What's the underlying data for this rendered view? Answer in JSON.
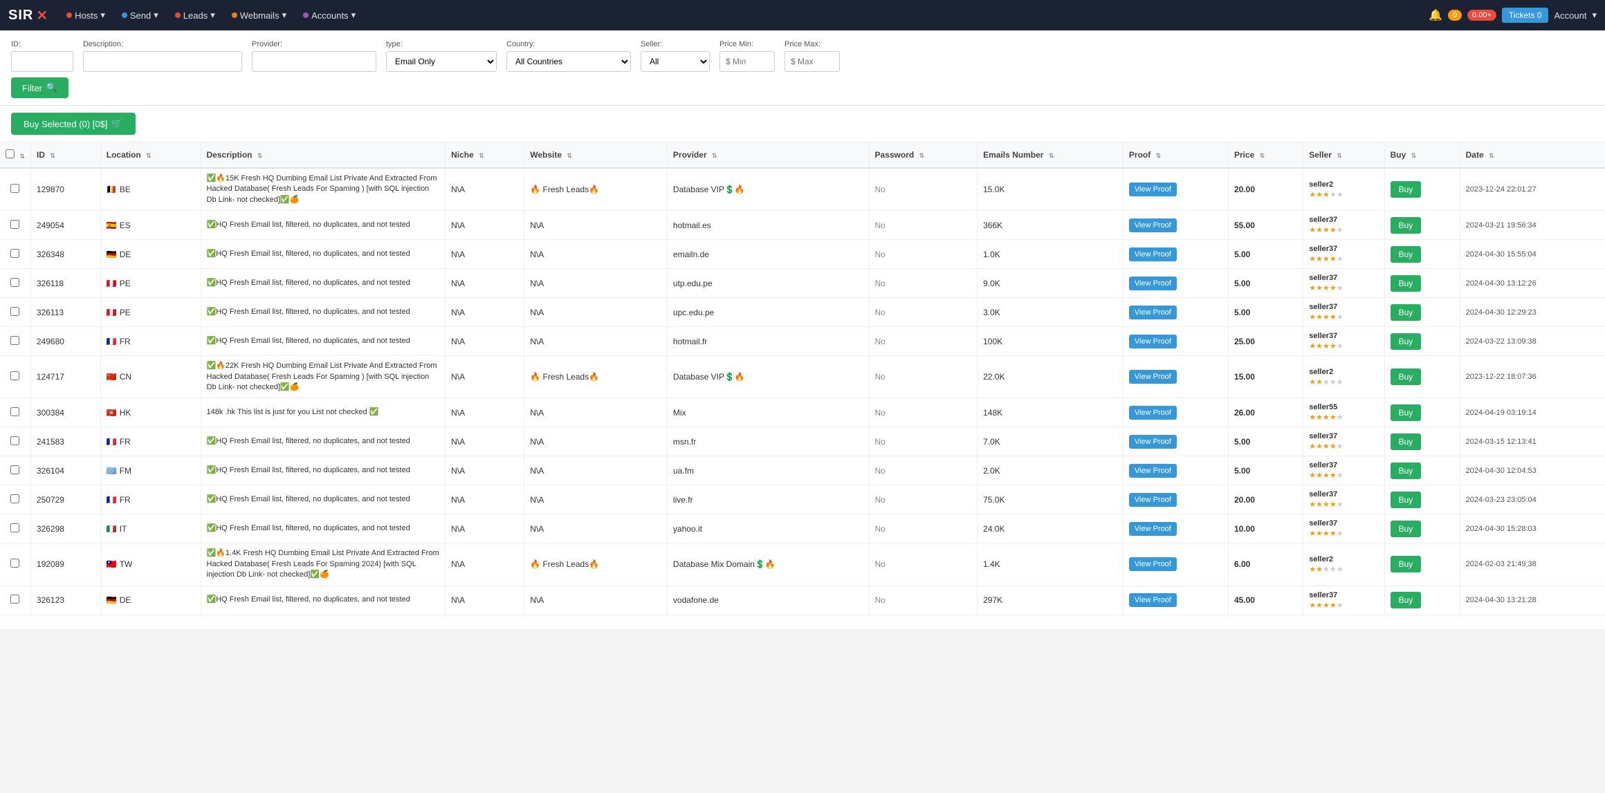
{
  "brand": {
    "sir": "SIR",
    "x": "✕"
  },
  "navbar": {
    "items": [
      {
        "id": "hosts",
        "label": "Hosts",
        "dot": "red",
        "hasArrow": true
      },
      {
        "id": "send",
        "label": "Send",
        "dot": "blue",
        "hasArrow": true
      },
      {
        "id": "leads",
        "label": "Leads",
        "dot": "red",
        "hasArrow": true
      },
      {
        "id": "webmails",
        "label": "Webmails",
        "dot": "orange",
        "hasArrow": true
      },
      {
        "id": "accounts",
        "label": "Accounts",
        "dot": "purple",
        "hasArrow": true
      }
    ],
    "right": {
      "bell_label": "🔔",
      "bell_count": "0",
      "red_count": "0.00+",
      "tickets_label": "Tickets",
      "tickets_count": "0",
      "account_label": "Account"
    }
  },
  "filters": {
    "id_label": "ID:",
    "description_label": "Description:",
    "provider_label": "Provider:",
    "type_label": "type:",
    "country_label": "Country:",
    "seller_label": "Seller:",
    "price_min_label": "Price Min:",
    "price_max_label": "Price Max:",
    "type_default": "Email Only",
    "country_default": "All Countries",
    "seller_default": "All",
    "price_min_placeholder": "$ Min",
    "price_max_placeholder": "$ Max",
    "filter_btn": "Filter"
  },
  "buy_selected": {
    "label": "Buy Selected (0) [0$]",
    "icon": "🛒"
  },
  "table": {
    "columns": [
      "",
      "ID",
      "Location",
      "Description",
      "Niche",
      "Website",
      "Provider",
      "Password",
      "Emails Number",
      "Proof",
      "Price",
      "Seller",
      "Buy",
      "Date"
    ],
    "rows": [
      {
        "id": "129870",
        "flag": "🇧🇪",
        "location": "BE",
        "description": "✅🔥15K Fresh HQ Dumbing Email List Private And Extracted From Hacked Database( Fresh Leads For Spaming ) [with SQL injection Db Link- not checked]✅🍊",
        "niche": "N\\A",
        "website": "🔥 Fresh Leads🔥",
        "provider": "Database VIP💲🔥",
        "password": "No",
        "emails_number": "15.0K",
        "price": "20.00",
        "seller": "seller2",
        "stars": 3,
        "date": "2023-12-24 22:01:27"
      },
      {
        "id": "249054",
        "flag": "🇪🇸",
        "location": "ES",
        "description": "✅HQ Fresh Email list, filtered, no duplicates, and not tested",
        "niche": "N\\A",
        "website": "N\\A",
        "provider": "hotmail.es",
        "password": "No",
        "emails_number": "366K",
        "price": "55.00",
        "seller": "seller37",
        "stars": 4,
        "date": "2024-03-21 19:56:34"
      },
      {
        "id": "326348",
        "flag": "🇩🇪",
        "location": "DE",
        "description": "✅HQ Fresh Email list, filtered, no duplicates, and not tested",
        "niche": "N\\A",
        "website": "N\\A",
        "provider": "emailn.de",
        "password": "No",
        "emails_number": "1.0K",
        "price": "5.00",
        "seller": "seller37",
        "stars": 4,
        "date": "2024-04-30 15:55:04"
      },
      {
        "id": "326118",
        "flag": "🇵🇪",
        "location": "PE",
        "description": "✅HQ Fresh Email list, filtered, no duplicates, and not tested",
        "niche": "N\\A",
        "website": "N\\A",
        "provider": "utp.edu.pe",
        "password": "No",
        "emails_number": "9.0K",
        "price": "5.00",
        "seller": "seller37",
        "stars": 4,
        "date": "2024-04-30 13:12:26"
      },
      {
        "id": "326113",
        "flag": "🇵🇪",
        "location": "PE",
        "description": "✅HQ Fresh Email list, filtered, no duplicates, and not tested",
        "niche": "N\\A",
        "website": "N\\A",
        "provider": "upc.edu.pe",
        "password": "No",
        "emails_number": "3.0K",
        "price": "5.00",
        "seller": "seller37",
        "stars": 4,
        "date": "2024-04-30 12:29:23"
      },
      {
        "id": "249680",
        "flag": "🇫🇷",
        "location": "FR",
        "description": "✅HQ Fresh Email list, filtered, no duplicates, and not tested",
        "niche": "N\\A",
        "website": "N\\A",
        "provider": "hotmail.fr",
        "password": "No",
        "emails_number": "100K",
        "price": "25.00",
        "seller": "seller37",
        "stars": 4,
        "date": "2024-03-22 13:09:38"
      },
      {
        "id": "124717",
        "flag": "🇨🇳",
        "location": "CN",
        "description": "✅🔥22K Fresh HQ Dumbing Email List Private And Extracted From Hacked Database( Fresh Leads For Spaming ) [with SQL injection Db Link- not checked]✅🍊",
        "niche": "N\\A",
        "website": "🔥 Fresh Leads🔥",
        "provider": "Database VIP💲🔥",
        "password": "No",
        "emails_number": "22.0K",
        "price": "15.00",
        "seller": "seller2",
        "stars": 2,
        "date": "2023-12-22 18:07:36"
      },
      {
        "id": "300384",
        "flag": "🇭🇰",
        "location": "HK",
        "description": "148k .hk This list is just for you List not checked ✅",
        "niche": "N\\A",
        "website": "N\\A",
        "provider": "Mix",
        "password": "No",
        "emails_number": "148K",
        "price": "26.00",
        "seller": "seller55",
        "stars": 4,
        "date": "2024-04-19 03:19:14"
      },
      {
        "id": "241583",
        "flag": "🇫🇷",
        "location": "FR",
        "description": "✅HQ Fresh Email list, filtered, no duplicates, and not tested",
        "niche": "N\\A",
        "website": "N\\A",
        "provider": "msn.fr",
        "password": "No",
        "emails_number": "7.0K",
        "price": "5.00",
        "seller": "seller37",
        "stars": 4,
        "date": "2024-03-15 12:13:41"
      },
      {
        "id": "326104",
        "flag": "🇫🇲",
        "location": "FM",
        "description": "✅HQ Fresh Email list, filtered, no duplicates, and not tested",
        "niche": "N\\A",
        "website": "N\\A",
        "provider": "ua.fm",
        "password": "No",
        "emails_number": "2.0K",
        "price": "5.00",
        "seller": "seller37",
        "stars": 4,
        "date": "2024-04-30 12:04:53"
      },
      {
        "id": "250729",
        "flag": "🇫🇷",
        "location": "FR",
        "description": "✅HQ Fresh Email list, filtered, no duplicates, and not tested",
        "niche": "N\\A",
        "website": "N\\A",
        "provider": "live.fr",
        "password": "No",
        "emails_number": "75.0K",
        "price": "20.00",
        "seller": "seller37",
        "stars": 4,
        "date": "2024-03-23 23:05:04"
      },
      {
        "id": "326298",
        "flag": "🇮🇹",
        "location": "IT",
        "description": "✅HQ Fresh Email list, filtered, no duplicates, and not tested",
        "niche": "N\\A",
        "website": "N\\A",
        "provider": "yahoo.it",
        "password": "No",
        "emails_number": "24.0K",
        "price": "10.00",
        "seller": "seller37",
        "stars": 4,
        "date": "2024-04-30 15:28:03"
      },
      {
        "id": "192089",
        "flag": "🇹🇼",
        "location": "TW",
        "description": "✅🔥1.4K Fresh HQ Dumbing Email List Private And Extracted From Hacked Database( Fresh Leads For Spaming 2024) [with SQL injection Db Link- not checked]✅🍊",
        "niche": "N\\A",
        "website": "🔥 Fresh Leads🔥",
        "provider": "Database Mix Domain💲🔥",
        "password": "No",
        "emails_number": "1.4K",
        "price": "6.00",
        "seller": "seller2",
        "stars": 2,
        "date": "2024-02-03 21:49:38"
      },
      {
        "id": "326123",
        "flag": "🇩🇪",
        "location": "DE",
        "description": "✅HQ Fresh Email list, filtered, no duplicates, and not tested",
        "niche": "N\\A",
        "website": "N\\A",
        "provider": "vodafone.de",
        "password": "No",
        "emails_number": "297K",
        "price": "45.00",
        "seller": "seller37",
        "stars": 4,
        "date": "2024-04-30 13:21:28"
      }
    ]
  }
}
